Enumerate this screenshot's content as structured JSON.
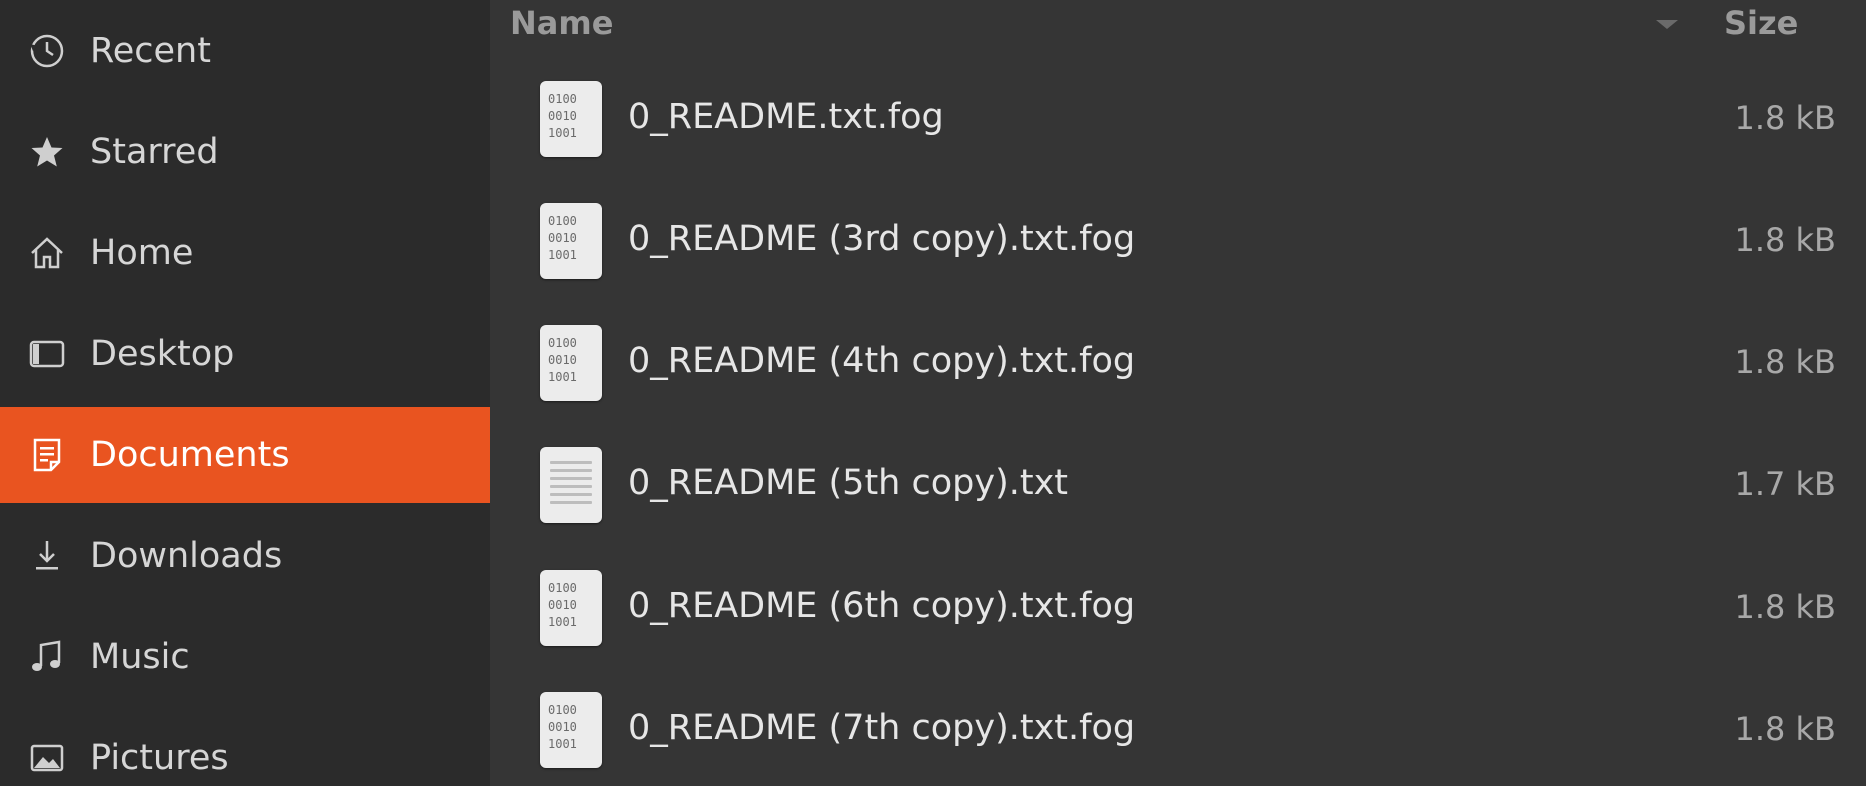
{
  "sidebar": {
    "items": [
      {
        "label": "Recent",
        "icon": "clock-icon"
      },
      {
        "label": "Starred",
        "icon": "star-icon"
      },
      {
        "label": "Home",
        "icon": "home-icon"
      },
      {
        "label": "Desktop",
        "icon": "desktop-icon"
      },
      {
        "label": "Documents",
        "icon": "document-icon",
        "active": true
      },
      {
        "label": "Downloads",
        "icon": "download-icon"
      },
      {
        "label": "Music",
        "icon": "music-note-icon"
      },
      {
        "label": "Pictures",
        "icon": "picture-icon"
      }
    ],
    "active_color": "#e95420"
  },
  "list": {
    "headers": {
      "name": "Name",
      "size": "Size"
    },
    "files": [
      {
        "name": "0_README.txt.fog",
        "size": "1.8 kB",
        "icon": "binary-file-icon"
      },
      {
        "name": "0_README (3rd copy).txt.fog",
        "size": "1.8 kB",
        "icon": "binary-file-icon"
      },
      {
        "name": "0_README (4th copy).txt.fog",
        "size": "1.8 kB",
        "icon": "binary-file-icon"
      },
      {
        "name": "0_README (5th copy).txt",
        "size": "1.7 kB",
        "icon": "text-file-icon"
      },
      {
        "name": "0_README (6th copy).txt.fog",
        "size": "1.8 kB",
        "icon": "binary-file-icon"
      },
      {
        "name": "0_README (7th copy).txt.fog",
        "size": "1.8 kB",
        "icon": "binary-file-icon"
      }
    ]
  }
}
